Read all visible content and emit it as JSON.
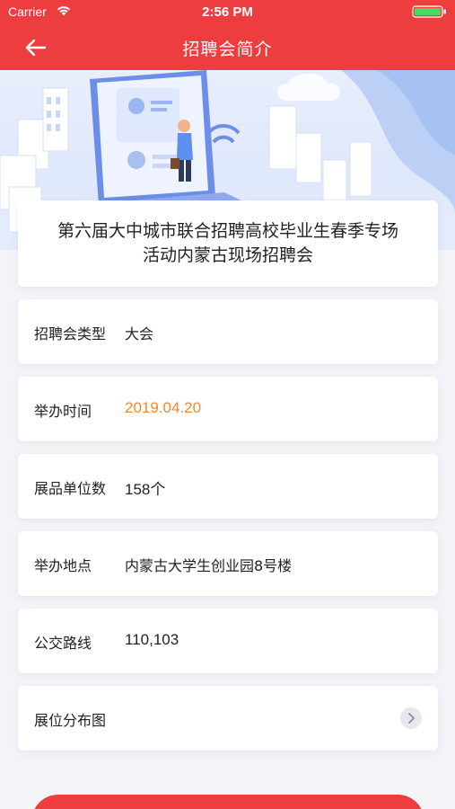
{
  "status_bar": {
    "carrier": "Carrier",
    "time": "2:56 PM"
  },
  "nav": {
    "title": "招聘会简介",
    "back_icon": "arrow-left-icon"
  },
  "fair": {
    "name": "第六届大中城市联合招聘高校毕业生春季专场活动内蒙古现场招聘会"
  },
  "rows": [
    {
      "label": "招聘会类型",
      "value": "大会"
    },
    {
      "label": "举办时间",
      "value": "2019.04.20"
    },
    {
      "label": "展品单位数",
      "value": "158个"
    },
    {
      "label": "举办地点",
      "value": "内蒙古大学生创业园8号楼"
    },
    {
      "label": "公交路线",
      "value": "110,103"
    },
    {
      "label": "展位分布图",
      "value": ""
    }
  ],
  "colors": {
    "brand_red": "#ee3d3f",
    "date_orange": "#ef8a2c"
  }
}
